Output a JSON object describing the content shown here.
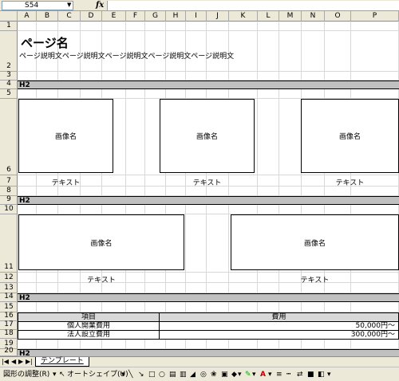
{
  "namebox": {
    "value": "S54",
    "fx": "fx"
  },
  "columns": [
    "A",
    "B",
    "C",
    "D",
    "E",
    "F",
    "G",
    "H",
    "I",
    "J",
    "K",
    "L",
    "M",
    "N",
    "O",
    "P"
  ],
  "rows": [
    "1",
    "2",
    "3",
    "4",
    "5",
    "6",
    "7",
    "8",
    "9",
    "10",
    "11",
    "12",
    "13",
    "14",
    "15",
    "16",
    "17",
    "18",
    "19",
    "20"
  ],
  "page": {
    "title": "ページ名",
    "description": "ページ説明文ページ説明文ページ説明文ページ説明文ページ説明文"
  },
  "sections": {
    "h2_1": "H2",
    "h2_2": "H2",
    "h2_3": "H2",
    "h2_4": "H2"
  },
  "images_row1": [
    {
      "label": "画像名",
      "caption": "テキスト"
    },
    {
      "label": "画像名",
      "caption": "テキスト"
    },
    {
      "label": "画像名",
      "caption": "テキスト"
    }
  ],
  "images_row2": [
    {
      "label": "画像名",
      "caption": "テキスト"
    },
    {
      "label": "画像名",
      "caption": "テキスト"
    }
  ],
  "cost_table": {
    "headers": [
      "項目",
      "費用"
    ],
    "rows": [
      [
        "個人開業費用",
        "50,000円〜"
      ],
      [
        "法人設立費用",
        "300,000円〜"
      ]
    ]
  },
  "sheet_tab": "テンプレート",
  "drawing_toolbar": {
    "draw_menu": "図形の調整(R)",
    "autoshape": "オートシェイプ(U)"
  }
}
